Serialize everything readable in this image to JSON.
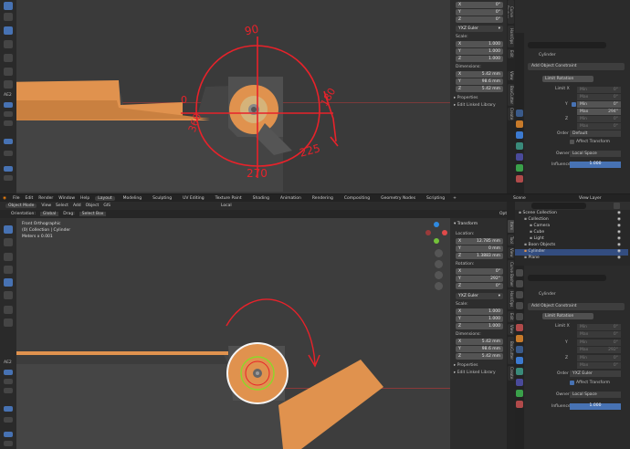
{
  "top": {
    "rotation": {
      "x": "0°",
      "y": "0°",
      "z": "0°"
    },
    "rotation_mode": "YXZ Euler",
    "scale_title": "Scale:",
    "scale": {
      "x": "1.000",
      "y": "1.000",
      "z": "1.000"
    },
    "dimensions_title": "Dimensions:",
    "dimensions": {
      "x": "5.42 mm",
      "y": "98.6 mm",
      "z": "5.42 mm"
    },
    "properties": "Properties",
    "edit_linked": "Edit Linked Library",
    "object": "Cylinder",
    "add_constraint": "Add Object Constraint",
    "constraint": "Limit Rotation",
    "limit_x": "Limit X",
    "x_min_label": "Min",
    "x_min": "0°",
    "x_max_label": "Max",
    "x_max": "0°",
    "y_axis": "Y",
    "y_min_label": "Min",
    "y_min": "0°",
    "y_max_label": "Max",
    "y_max": "294°",
    "z_axis": "Z",
    "z_min_label": "Min",
    "z_min": "0°",
    "z_max_label": "Max",
    "z_max": "0°",
    "order_label": "Order",
    "order": "Default",
    "affect_transform": "Affect Transform",
    "owner_label": "Owner",
    "owner": "Local Space",
    "influence_label": "Influence",
    "influence": "1.000",
    "annotations": {
      "a90": "90",
      "a0": "0",
      "a270": "270",
      "a225": "225",
      "a180": "180",
      "a360": "360"
    }
  },
  "topbar": {
    "menus": [
      "File",
      "Edit",
      "Render",
      "Window",
      "Help"
    ],
    "workspaces": [
      "Layout",
      "Modeling",
      "Sculpting",
      "UV Editing",
      "Texture Paint",
      "Shading",
      "Animation",
      "Rendering",
      "Compositing",
      "Geometry Nodes",
      "Scripting"
    ],
    "plus": "+",
    "scene": "Scene",
    "view_layer": "View Layer"
  },
  "header": {
    "mode": "Object Mode",
    "menus": [
      "View",
      "Select",
      "Add",
      "Object",
      "GIS"
    ],
    "orientation_label": "Orientation:",
    "orientation": "Global",
    "drag_label": "Drag:",
    "drag": "Select Box",
    "pivot": "Local",
    "options": "Options"
  },
  "viewport": {
    "view_name": "Front Orthographic",
    "collection": "(0) Collection | Cylinder",
    "units": "Meters x 0.001"
  },
  "transform": {
    "title": "Transform",
    "location_title": "Location:",
    "location": {
      "x": "12.785 mm",
      "y": "0 mm",
      "z": "1.3883 mm"
    },
    "rotation_title": "Rotation:",
    "rotation": {
      "x": "0°",
      "y": "292°",
      "z": "0°"
    },
    "rotation_mode": "YXZ Euler",
    "scale_title": "Scale:",
    "scale": {
      "x": "1.000",
      "y": "1.000",
      "z": "1.000"
    },
    "dimensions_title": "Dimensions:",
    "dimensions": {
      "x": "5.42 mm",
      "y": "98.6 mm",
      "z": "5.42 mm"
    },
    "properties": "Properties",
    "edit_linked": "Edit Linked Library"
  },
  "outliner": {
    "items": [
      {
        "label": "Scene Collection",
        "indent": 0
      },
      {
        "label": "Collection",
        "indent": 1
      },
      {
        "label": "Camera",
        "indent": 2
      },
      {
        "label": "Cube",
        "indent": 2
      },
      {
        "label": "Light",
        "indent": 2
      },
      {
        "label": "Boon Objects",
        "indent": 1
      },
      {
        "label": "Cylinder",
        "indent": 1,
        "selected": true
      },
      {
        "label": "Plane",
        "indent": 1
      }
    ]
  },
  "bottom_props": {
    "object": "Cylinder",
    "add_constraint": "Add Object Constraint",
    "constraint": "Limit Rotation",
    "limit_x": "Limit X",
    "x_min_label": "Min",
    "x_min": "0°",
    "x_max_label": "Max",
    "x_max": "0°",
    "y_axis": "Y",
    "y_min_label": "Min",
    "y_min": "0°",
    "y_max_label": "Max",
    "y_max": "292°",
    "z_axis": "Z",
    "z_min_label": "Min",
    "z_min": "0°",
    "z_max_label": "Max",
    "z_max": "0°",
    "order_label": "Order",
    "order": "YXZ Euler",
    "affect_transform": "Affect Transform",
    "owner_label": "Owner",
    "owner": "Local Space",
    "influence_label": "Influence",
    "influence": "1.000"
  },
  "sidebar_tabs": [
    "Item",
    "Tool",
    "View",
    "Create",
    "BoxCutter",
    "Edit",
    "Curve Basher",
    "HardOps"
  ],
  "tb_label": "AE2",
  "colors": {
    "accent": "#4772b3",
    "annotation": "#e8222a",
    "orange": "#e0924e",
    "viewport": "#3d3d3d",
    "panel": "#303030"
  }
}
